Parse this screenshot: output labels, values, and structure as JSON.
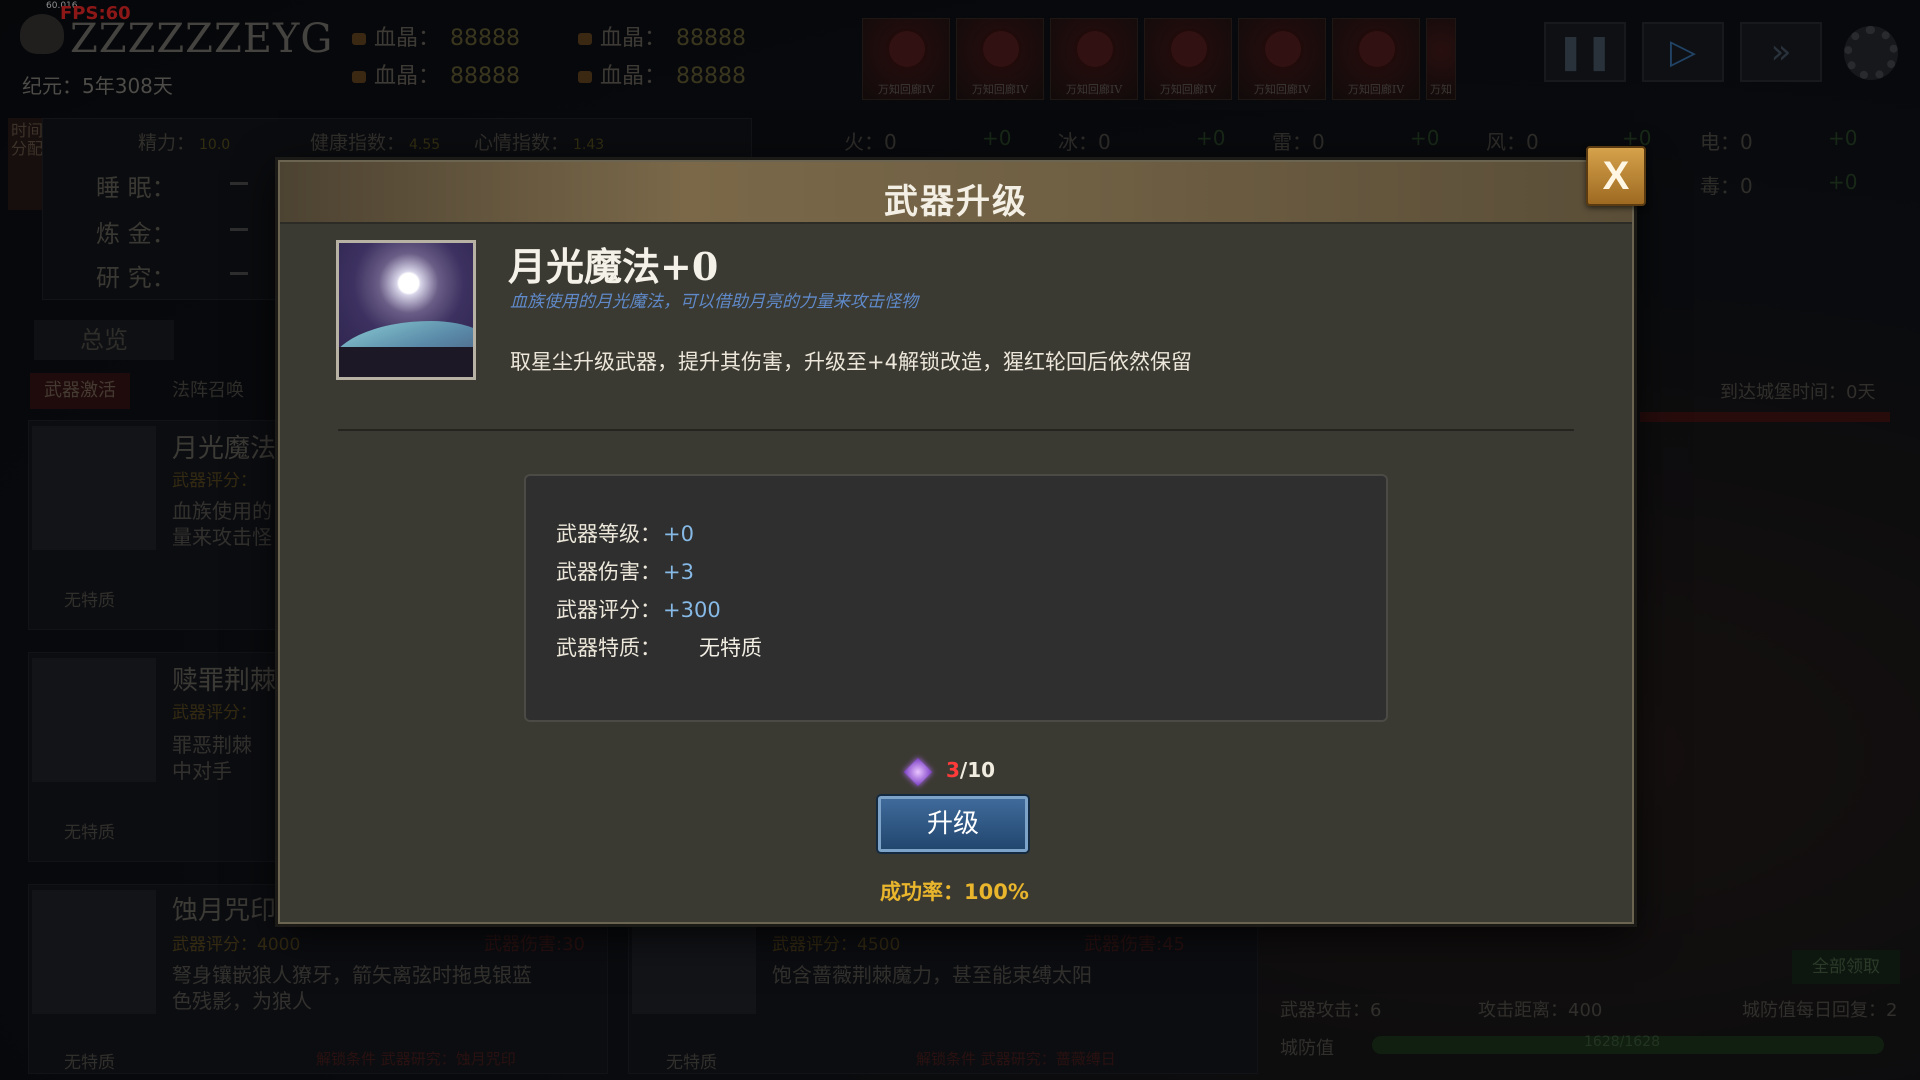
{
  "hud": {
    "fps_small": "60.016",
    "fps": "FPS:60",
    "player_name": "ZZZZZZEYG",
    "era": "纪元：5年308天",
    "resources": [
      {
        "label": "血晶：",
        "value": "88888"
      },
      {
        "label": "血晶：",
        "value": "88888"
      },
      {
        "label": "血晶：",
        "value": "88888"
      },
      {
        "label": "血晶：",
        "value": "88888"
      }
    ],
    "cards": [
      "万知回廊IV",
      "万知回廊IV",
      "万知回廊IV",
      "万知回廊IV",
      "万知回廊IV",
      "万知回廊IV",
      "万知"
    ],
    "controls": {
      "pause": "❚❚",
      "play": "▷",
      "fast": "»"
    }
  },
  "status": {
    "time_tab": "时间分配",
    "energy": {
      "label": "精力：",
      "value": "10.0"
    },
    "health": {
      "label": "健康指数：",
      "value": "4.55"
    },
    "mood": {
      "label": "心情指数：",
      "value": "1.43"
    },
    "activities": [
      "睡 眠：",
      "炼 金：",
      "研 究："
    ]
  },
  "elements": [
    {
      "label": "火：0",
      "plus": "+0"
    },
    {
      "label": "冰：0",
      "plus": "+0"
    },
    {
      "label": "雷：0",
      "plus": "+0"
    },
    {
      "label": "风：0",
      "plus": "+0"
    },
    {
      "label": "电：0",
      "plus": "+0"
    },
    {
      "label": "毒：0",
      "plus": "+0"
    }
  ],
  "tabs": {
    "overview": "总览",
    "sub_active": "武器激活",
    "sub_inactive": "法阵召唤"
  },
  "weapons_bg": [
    {
      "name": "月光魔法",
      "score": "武器评分：",
      "desc1": "血族使用的",
      "desc2": "量来攻击怪",
      "trait": "无特质"
    },
    {
      "name": "赎罪荆棘",
      "score": "武器评分：",
      "desc1": "罪恶荆棘",
      "desc2": "中对手",
      "trait": "无特质"
    },
    {
      "name": "蚀月咒印",
      "score": "武器评分：4000",
      "lock": "武器伤害:30",
      "desc1": "弩身镶嵌狼人獠牙，箭矢离弦时拖曳银蓝",
      "desc2": "色残影，为狼人",
      "trait": "无特质",
      "req": "解锁条件  武器研究：蚀月咒印"
    },
    {
      "score": "武器评分：4500",
      "lock": "武器伤害:45",
      "desc1": "饱含蔷薇荆棘魔力，甚至能束缚太阳",
      "trait": "无特质",
      "req": "解锁条件  武器研究：蔷薇缚日"
    }
  ],
  "right_panel": {
    "arrive_time": "到达城堡时间：0天",
    "claim_all": "全部领取",
    "weapon_attack": "武器攻击：6",
    "attack_range": "攻击距离：400",
    "daily_recover": "城防值每日回复：2",
    "defense_label": "城防值",
    "defense_value": "1628/1628"
  },
  "modal": {
    "title": "武器升级",
    "close_label": "X",
    "weapon_name": "月光魔法+0",
    "weapon_subtitle": "血族使用的月光魔法，可以借助月亮的力量来攻击怪物",
    "description": "取星尘升级武器，提升其伤害，升级至+4解锁改造，猩红轮回后依然保留",
    "stats": [
      {
        "label": "武器等级：",
        "value": "+0"
      },
      {
        "label": "武器伤害：",
        "value": "+3"
      },
      {
        "label": "武器评分：",
        "value": "+300"
      }
    ],
    "trait_label": "武器特质：",
    "trait_value": "无特质",
    "cost_current": "3",
    "cost_total": "/10",
    "upgrade_label": "升级",
    "success_rate": "成功率：100%"
  }
}
